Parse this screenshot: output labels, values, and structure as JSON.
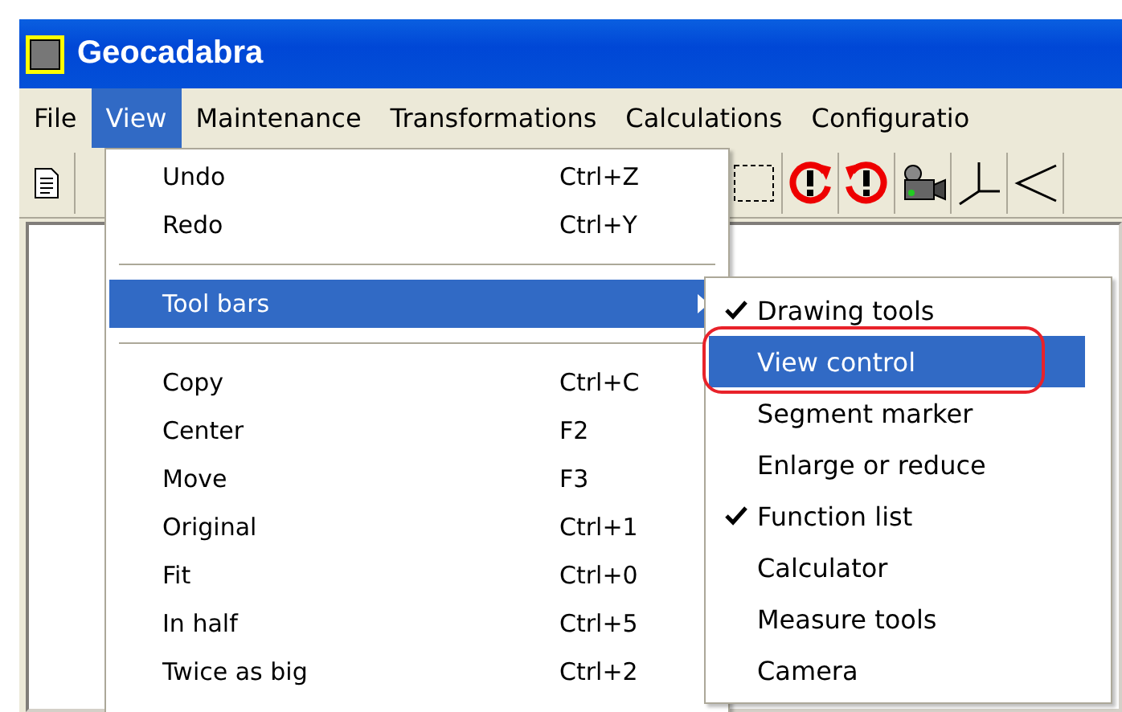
{
  "window": {
    "title": "Geocadabra"
  },
  "menu_bar": [
    {
      "label": "File",
      "selected": false
    },
    {
      "label": "View",
      "selected": true
    },
    {
      "label": "Maintenance",
      "selected": false
    },
    {
      "label": "Transformations",
      "selected": false
    },
    {
      "label": "Calculations",
      "selected": false
    },
    {
      "label": "Configuratio",
      "selected": false
    }
  ],
  "view_menu": [
    {
      "kind": "item",
      "label": "Undo",
      "shortcut": "Ctrl+Z",
      "selected": false
    },
    {
      "kind": "item",
      "label": "Redo",
      "shortcut": "Ctrl+Y",
      "selected": false
    },
    {
      "kind": "separator"
    },
    {
      "kind": "submenu",
      "label": "Tool bars",
      "selected": true
    },
    {
      "kind": "separator"
    },
    {
      "kind": "item",
      "label": "Copy",
      "shortcut": "Ctrl+C",
      "selected": false
    },
    {
      "kind": "item",
      "label": "Center",
      "shortcut": "F2",
      "selected": false
    },
    {
      "kind": "item",
      "label": "Move",
      "shortcut": "F3",
      "selected": false
    },
    {
      "kind": "item",
      "label": "Original",
      "shortcut": "Ctrl+1",
      "selected": false
    },
    {
      "kind": "item",
      "label": "Fit",
      "shortcut": "Ctrl+0",
      "selected": false
    },
    {
      "kind": "item",
      "label": "In half",
      "shortcut": "Ctrl+5",
      "selected": false
    },
    {
      "kind": "item",
      "label": "Twice as big",
      "shortcut": "Ctrl+2",
      "selected": false
    }
  ],
  "toolbars_submenu": [
    {
      "label": "Drawing tools",
      "checked": true,
      "selected": false
    },
    {
      "label": "View control",
      "checked": false,
      "selected": true
    },
    {
      "label": "Segment marker",
      "checked": false,
      "selected": false
    },
    {
      "label": "Enlarge or reduce",
      "checked": false,
      "selected": false
    },
    {
      "label": "Function list",
      "checked": true,
      "selected": false
    },
    {
      "label": "Calculator",
      "checked": false,
      "selected": false
    },
    {
      "label": "Measure tools",
      "checked": false,
      "selected": false
    },
    {
      "label": "Camera",
      "checked": false,
      "selected": false
    }
  ]
}
